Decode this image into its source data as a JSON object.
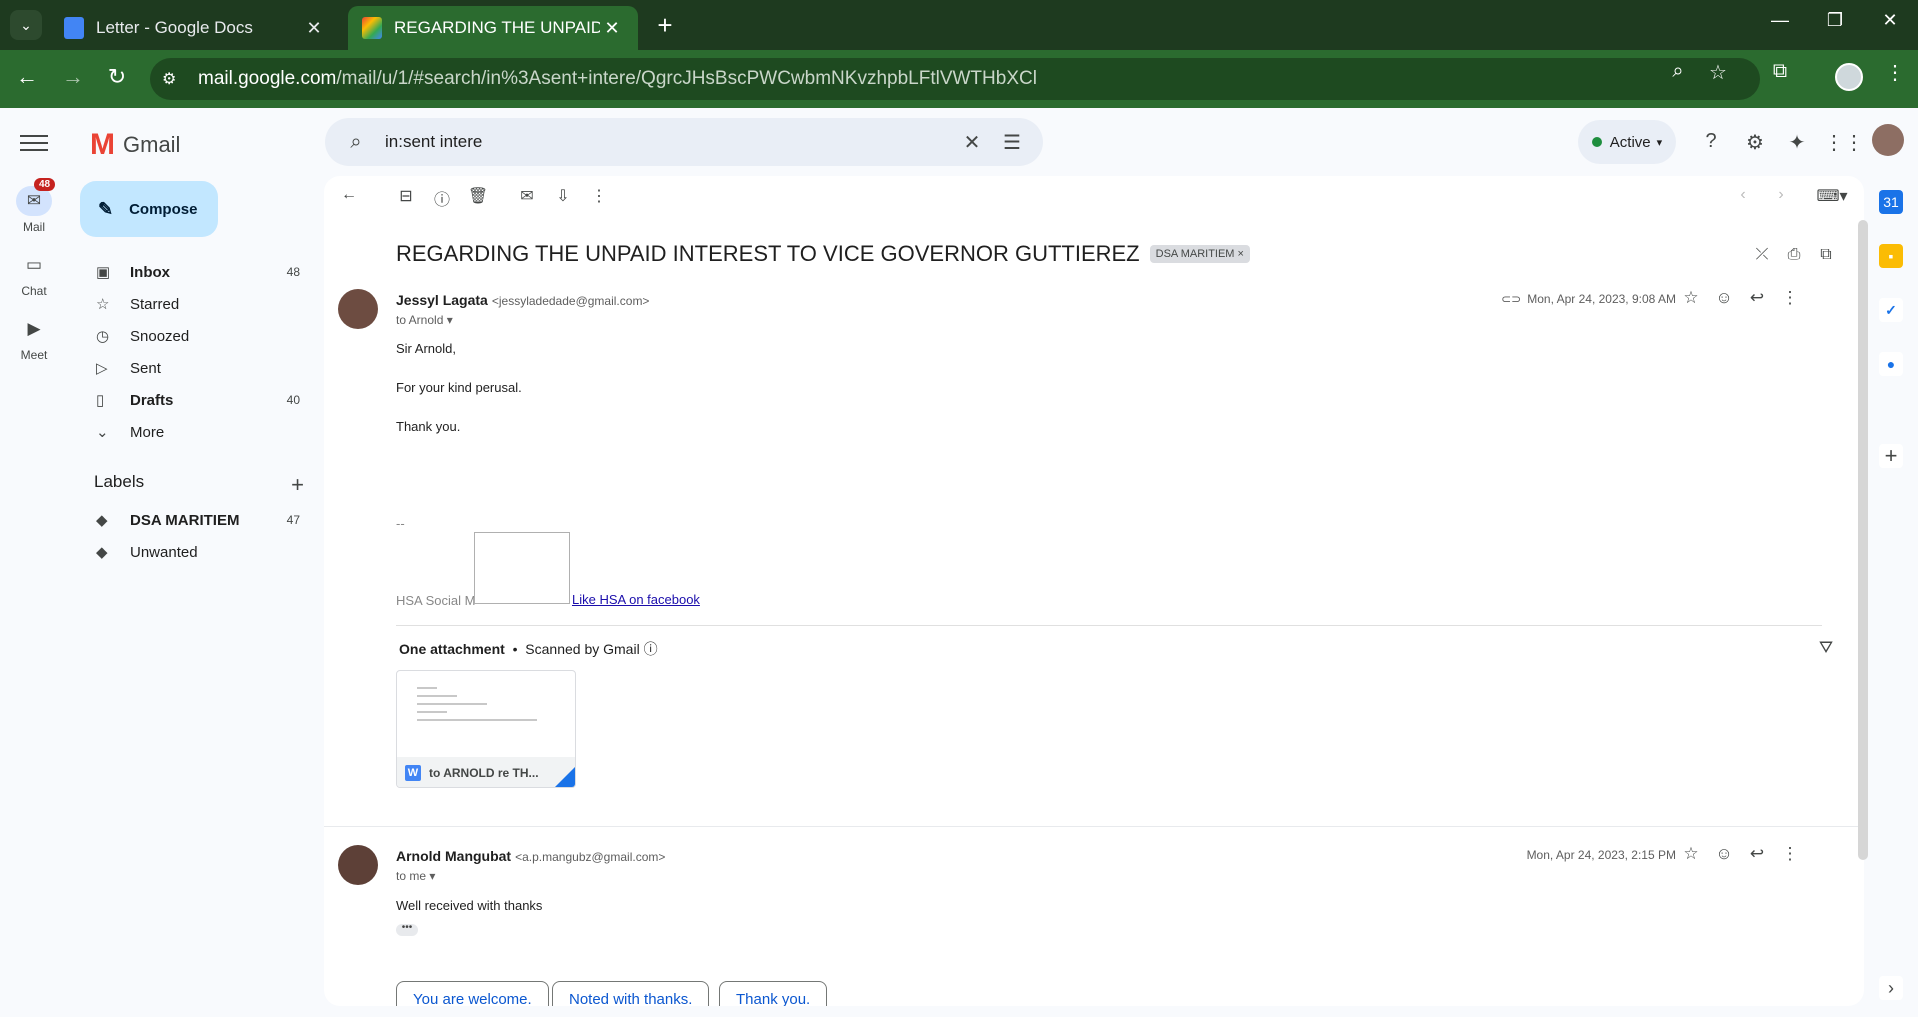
{
  "browser": {
    "tabs": [
      {
        "title": "Letter - Google Docs",
        "active": false
      },
      {
        "title": "REGARDING THE UNPAID INTER",
        "active": true
      }
    ],
    "url_host": "mail.google.com",
    "url_path": "/mail/u/1/#search/in%3Asent+intere/QgrcJHsBscPWCwbmNKvzhpbLFtlVWTHbXCl"
  },
  "gmail": {
    "app_name": "Gmail",
    "search_query": "in:sent intere",
    "status": "Active",
    "rail": [
      {
        "label": "Mail",
        "badge": "48"
      },
      {
        "label": "Chat"
      },
      {
        "label": "Meet"
      }
    ],
    "compose_label": "Compose",
    "nav": [
      {
        "label": "Inbox",
        "count": "48",
        "bold": true
      },
      {
        "label": "Starred",
        "count": ""
      },
      {
        "label": "Snoozed",
        "count": ""
      },
      {
        "label": "Sent",
        "count": ""
      },
      {
        "label": "Drafts",
        "count": "40",
        "bold": true
      },
      {
        "label": "More",
        "count": ""
      }
    ],
    "labels_title": "Labels",
    "labels": [
      {
        "label": "DSA MARITIEM",
        "count": "47",
        "bold": true
      },
      {
        "label": "Unwanted",
        "count": ""
      }
    ]
  },
  "thread": {
    "subject": "REGARDING THE UNPAID INTEREST TO VICE GOVERNOR GUTTIEREZ",
    "label_chip": "DSA MARITIEM",
    "messages": [
      {
        "sender_name": "Jessyl Lagata",
        "sender_email": "<jessyladedade@gmail.com>",
        "to": "to Arnold",
        "date": "Mon, Apr 24, 2023, 9:08 AM",
        "body": [
          "Sir Arnold,",
          "For your kind perusal.",
          "Thank you."
        ],
        "signature_sep": "--",
        "signature_text": "HSA Social M",
        "signature_link": "Like HSA on facebook",
        "attachment_header": "One attachment",
        "attachment_scan": "Scanned by Gmail",
        "attachment_name": "to ARNOLD re TH..."
      },
      {
        "sender_name": "Arnold Mangubat",
        "sender_email": "<a.p.mangubz@gmail.com>",
        "to": "to me",
        "date": "Mon, Apr 24, 2023, 2:15 PM",
        "body": [
          "Well received with thanks"
        ]
      }
    ],
    "smart_replies": [
      "You are welcome.",
      "Noted with thanks.",
      "Thank you."
    ]
  }
}
